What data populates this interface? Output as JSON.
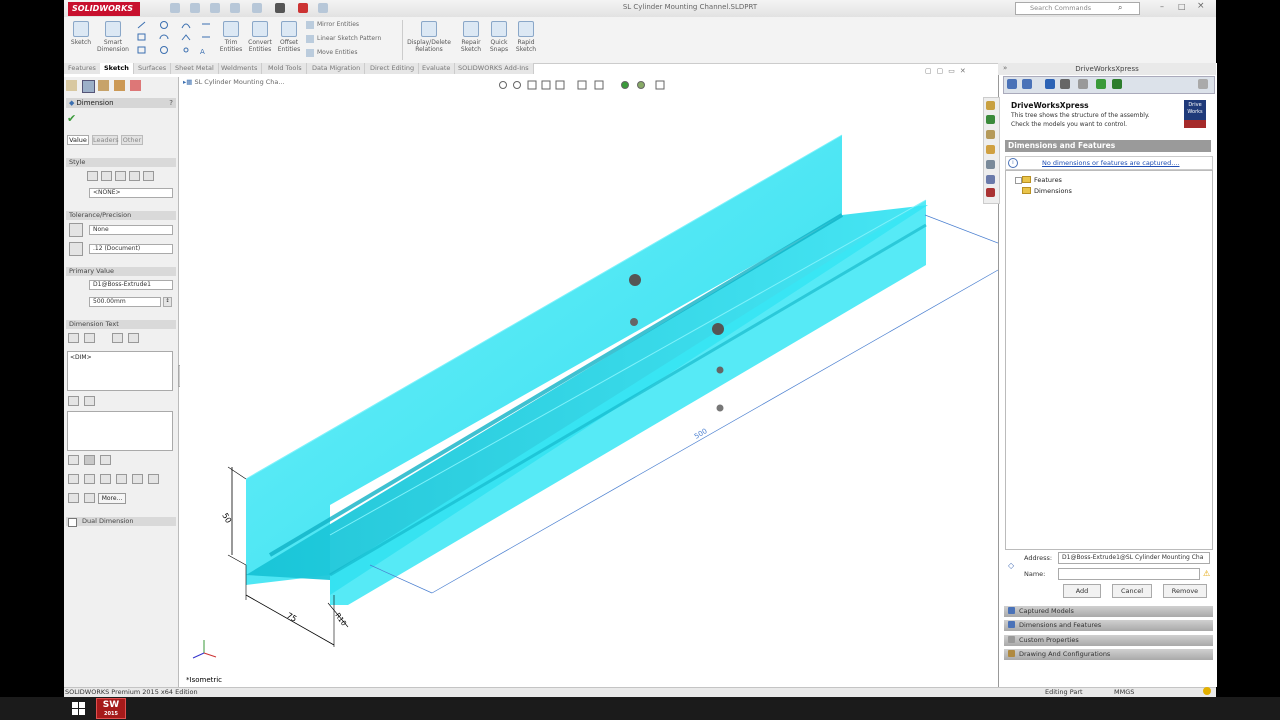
{
  "app": {
    "logo": "SOLIDWORKS",
    "window_title": "SL Cylinder Mounting Channel.SLDPRT",
    "search_placeholder": "Search Commands"
  },
  "ribbon": {
    "sketch": "Sketch",
    "smart_dimension": "Smart Dimension",
    "trim_entities": "Trim Entities",
    "convert_entities": "Convert Entities",
    "offset_entities": "Offset Entities",
    "mirror_entities": "Mirror Entities",
    "linear_sketch_pattern": "Linear Sketch Pattern",
    "move_entities": "Move Entities",
    "display_delete_relations": "Display/Delete Relations",
    "repair_sketch": "Repair Sketch",
    "quick_snaps": "Quick Snaps",
    "rapid_sketch": "Rapid Sketch"
  },
  "tabs": [
    "Features",
    "Sketch",
    "Surfaces",
    "Sheet Metal",
    "Weldments",
    "Mold Tools",
    "Data Migration",
    "Direct Editing",
    "Evaluate",
    "SOLIDWORKS Add-Ins"
  ],
  "active_tab": "Sketch",
  "property_manager": {
    "title": "Dimension",
    "subtabs": [
      "Value",
      "Leaders",
      "Other"
    ],
    "style_header": "Style",
    "style_value": "<NONE>",
    "tolerance_header": "Tolerance/Precision",
    "tolerance_value": "None",
    "precision_value": ".12 (Document)",
    "primary_header": "Primary Value",
    "primary_name": "D1@Boss-Extrude1",
    "primary_value": "500.00mm",
    "dimtext_header": "Dimension Text",
    "dimtext_value": "<DIM>",
    "more_button": "More...",
    "dual_dimension": "Dual Dimension"
  },
  "graphics": {
    "tree_item": "SL Cylinder Mounting Cha...",
    "view_label": "*Isometric",
    "dim_50": "50",
    "dim_75": "75",
    "dim_r10": "R10",
    "dim_500": "500"
  },
  "driveworks": {
    "pane_title": "DriveWorksXpress",
    "heading": "DriveWorksXpress",
    "desc_line1": "This tree shows the structure of the assembly.",
    "desc_line2": "Check the models you want to control.",
    "logo_text": "Drive Works",
    "section_title": "Dimensions and Features",
    "info_link": "No dimensions or features are captured....",
    "tree_features": "Features",
    "tree_dimensions": "Dimensions",
    "address_label": "Address:",
    "address_value": "D1@Boss-Extrude1@SL Cylinder Mounting Cha",
    "name_label": "Name:",
    "name_value": "",
    "add_button": "Add",
    "cancel_button": "Cancel",
    "remove_button": "Remove",
    "bars": [
      "Captured Models",
      "Dimensions and Features",
      "Custom Properties",
      "Drawing And Configurations"
    ]
  },
  "status": {
    "left": "SOLIDWORKS Premium 2015 x64 Edition",
    "editing": "Editing Part",
    "units": "MMGS"
  },
  "taskbar": {
    "app_label": "SW",
    "app_year": "2015"
  },
  "colors": {
    "part_cyan": "#2fe3f2",
    "solidworks_red": "#c8102e"
  }
}
